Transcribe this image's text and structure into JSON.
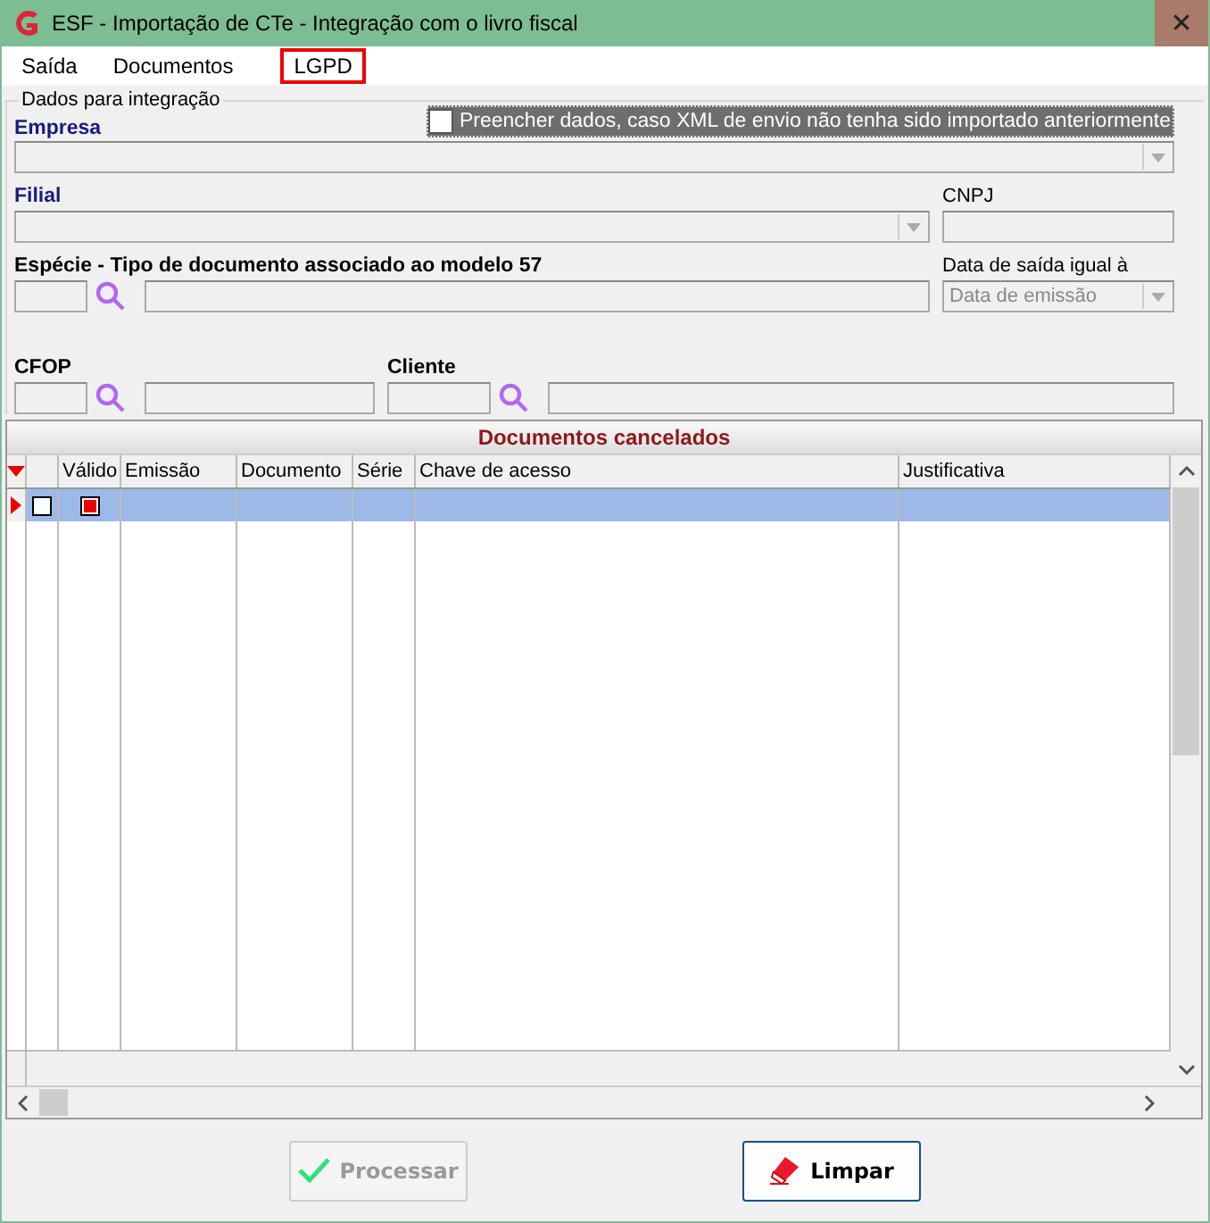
{
  "window": {
    "title": "ESF - Importação de CTe - Integração com o livro fiscal",
    "close": "✕"
  },
  "menu": [
    {
      "label": "Saída",
      "highlighted": false
    },
    {
      "label": "Documentos",
      "highlighted": false
    },
    {
      "label": "LGPD",
      "highlighted": true
    }
  ],
  "group": {
    "title": "Dados para integração",
    "empresa": {
      "label": "Empresa"
    },
    "fill_option": {
      "label": "Preencher dados, caso XML de envio não tenha sido importado anteriormente",
      "checked": false
    },
    "filial": {
      "label": "Filial"
    },
    "cnpj": {
      "label": "CNPJ"
    },
    "especie": {
      "label": "Espécie - Tipo de documento associado ao modelo 57"
    },
    "data_saida": {
      "label": "Data de saída igual à",
      "value": "Data de emissão"
    },
    "cfop": {
      "label": "CFOP"
    },
    "cliente": {
      "label": "Cliente"
    }
  },
  "grid": {
    "title": "Documentos cancelados",
    "columns": [
      "Válido",
      "Emissão",
      "Documento",
      "Série",
      "Chave de acesso",
      "Justificativa"
    ],
    "rows": [
      {
        "checked": false,
        "valid": true,
        "selected": true
      }
    ]
  },
  "buttons": [
    {
      "label": "Processar",
      "kind": "ok",
      "disabled": true
    },
    {
      "label": "Limpar",
      "kind": "clear",
      "disabled": false
    }
  ]
}
